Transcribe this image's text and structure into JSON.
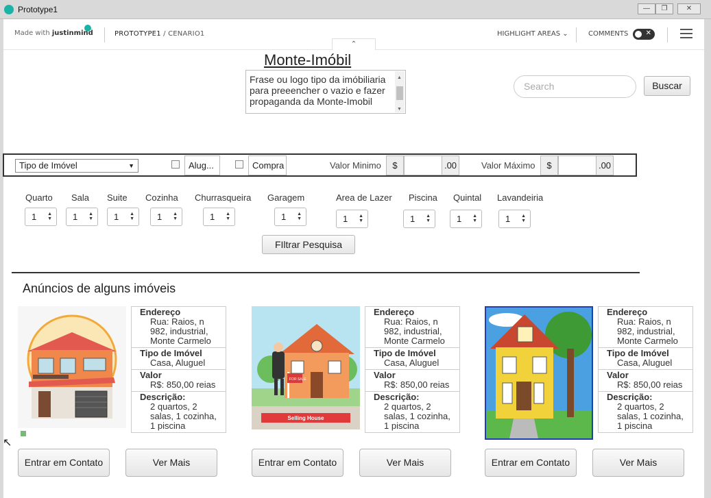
{
  "window": {
    "title": "Prototype1"
  },
  "jm_header": {
    "brand_made": "Made with",
    "brand_name": "justinmind",
    "crumb_project": "PROTOTYPE1",
    "crumb_sep": " / ",
    "crumb_scenario": "CENARIO1",
    "highlight": "HIGHLIGHT AREAS",
    "comments": "COMMENTS"
  },
  "site": {
    "title": "Monte-Imóbil",
    "tagline": "Frase ou logo tipo da imóbiliaria para preeencher o vazio e fazer propaganda da Monte-Imobil",
    "search_placeholder": "Search",
    "search_button": "Buscar"
  },
  "filters": {
    "tipo": "Tipo de Imóvel",
    "aluguel": "Alug...",
    "compra": "Compra",
    "valor_min_label": "Valor Minimo",
    "valor_max_label": "Valor Máximo",
    "currency": "$",
    "cents": ".00"
  },
  "rooms": [
    {
      "label": "Quarto",
      "value": "1"
    },
    {
      "label": "Sala",
      "value": "1"
    },
    {
      "label": "Suite",
      "value": "1"
    },
    {
      "label": "Cozinha",
      "value": "1"
    },
    {
      "label": "Churrasqueira",
      "value": "1"
    },
    {
      "label": "Garagem",
      "value": "1"
    },
    {
      "label": "Area de Lazer",
      "value": "1"
    },
    {
      "label": "Piscina",
      "value": "1"
    },
    {
      "label": "Quintal",
      "value": "1"
    },
    {
      "label": "Lavandeiria",
      "value": "1"
    }
  ],
  "filter_button": "FIltrar Pesquisa",
  "section_title": "Anúncios de alguns imóveis",
  "listings": [
    {
      "endereco_h": "Endereço",
      "endereco": "Rua: Raios, n 982, industrial, Monte Carmelo",
      "tipo_h": "Tipo de Imóvel",
      "tipo": "Casa, Aluguel",
      "valor_h": "Valor",
      "valor": "R$: 850,00 reias",
      "desc_h": "Descrição:",
      "desc": "2 quartos, 2 salas, 1 cozinha, 1 piscina",
      "contact": "Entrar em Contato",
      "more": "Ver Mais"
    },
    {
      "endereco_h": "Endereço",
      "endereco": "Rua: Raios, n 982, industrial, Monte Carmelo",
      "tipo_h": "Tipo de Imóvel",
      "tipo": "Casa, Aluguel",
      "valor_h": "Valor",
      "valor": "R$: 850,00 reias",
      "desc_h": "Descrição:",
      "desc": "2 quartos, 2 salas, 1 cozinha, 1 piscina",
      "contact": "Entrar em Contato",
      "more": "Ver Mais",
      "sign": "Selling House",
      "for_sale": "FOR SALE"
    },
    {
      "endereco_h": "Endereço",
      "endereco": "Rua: Raios, n 982, industrial, Monte Carmelo",
      "tipo_h": "Tipo de Imóvel",
      "tipo": "Casa, Aluguel",
      "valor_h": "Valor",
      "valor": "R$: 850,00 reias",
      "desc_h": "Descrição:",
      "desc": "2 quartos, 2 salas, 1 cozinha, 1 piscina",
      "contact": "Entrar em Contato",
      "more": "Ver Mais"
    }
  ]
}
